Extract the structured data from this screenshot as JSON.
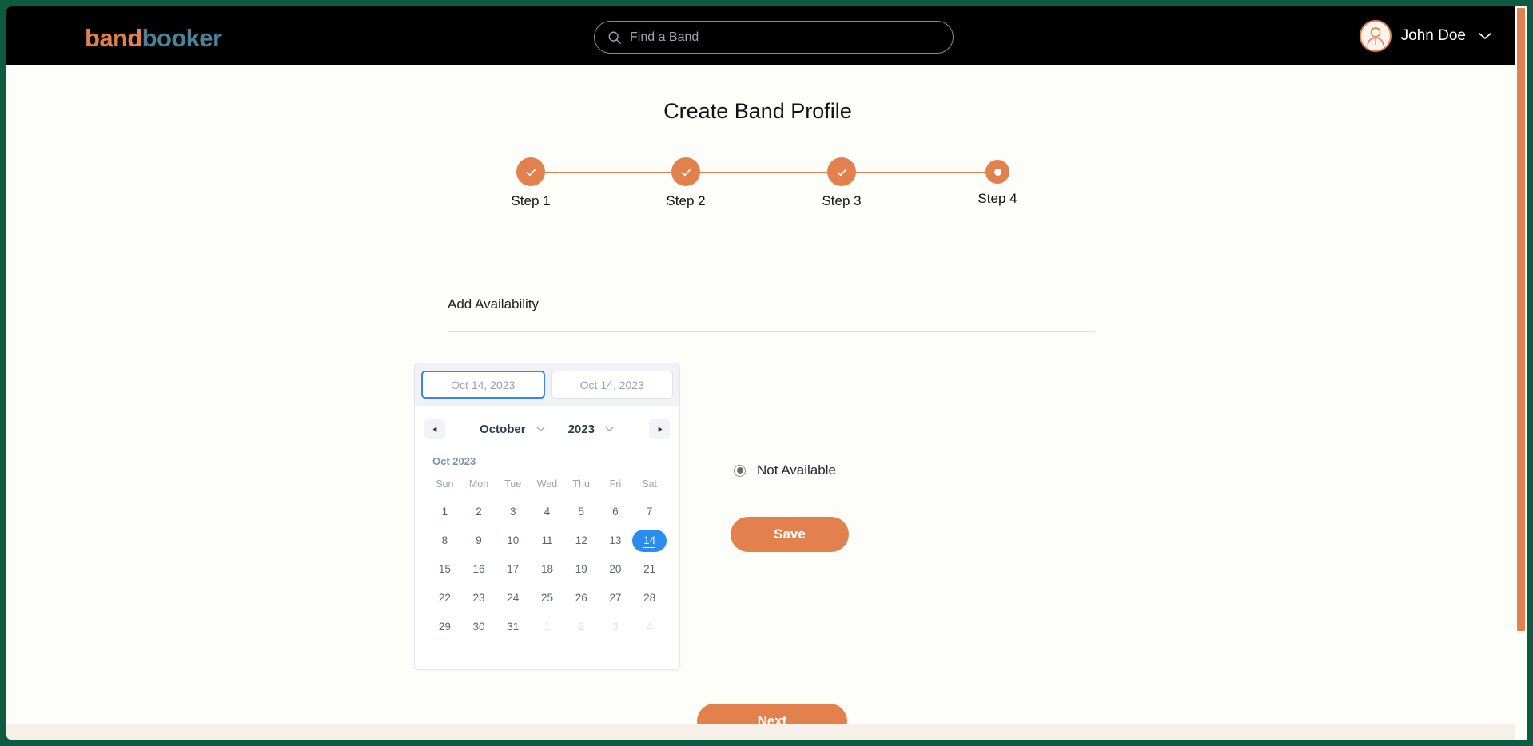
{
  "header": {
    "logo_part1": "band",
    "logo_part2": "booker",
    "logo_color_1": "#e2814e",
    "logo_color_2": "#4a8296",
    "search": {
      "value": "",
      "placeholder": "Find a Band",
      "icon": "search-icon"
    },
    "notifications": {
      "icon": "bell-icon",
      "has_unread_dot": true,
      "dot_color": "#e2814e"
    },
    "user": {
      "name": "John Doe",
      "avatar_icon": "user-avatar-icon",
      "chevron_icon": "chevron-down-icon"
    }
  },
  "main": {
    "title": "Create Band Profile",
    "stepper": {
      "accent_color": "#e2814e",
      "steps": [
        {
          "label": "Step 1",
          "state": "completed",
          "icon": "check-icon"
        },
        {
          "label": "Step 2",
          "state": "completed",
          "icon": "check-icon"
        },
        {
          "label": "Step 3",
          "state": "completed",
          "icon": "check-icon"
        },
        {
          "label": "Step 4",
          "state": "current",
          "icon": "dot-icon"
        }
      ]
    },
    "section": {
      "heading": "Add Availability"
    },
    "date_picker": {
      "start_date": "Oct 14, 2023",
      "end_date": "Oct 14, 2023",
      "active_tab": "start",
      "focus_color": "#3b82f6",
      "prev_icon": "triangle-left-icon",
      "next_icon": "triangle-right-icon",
      "month": "October",
      "year": "2023",
      "month_chevron_icon": "chevron-down-icon",
      "year_chevron_icon": "chevron-down-icon",
      "caption": "Oct 2023",
      "weekdays": [
        "Sun",
        "Mon",
        "Tue",
        "Wed",
        "Thu",
        "Fri",
        "Sat"
      ],
      "selected_day": "14",
      "selected_color": "#2b8cf0",
      "weeks": [
        [
          {
            "d": "1",
            "muted": false
          },
          {
            "d": "2",
            "muted": false
          },
          {
            "d": "3",
            "muted": false
          },
          {
            "d": "4",
            "muted": false
          },
          {
            "d": "5",
            "muted": false
          },
          {
            "d": "6",
            "muted": false
          },
          {
            "d": "7",
            "muted": false
          }
        ],
        [
          {
            "d": "8",
            "muted": false
          },
          {
            "d": "9",
            "muted": false
          },
          {
            "d": "10",
            "muted": false
          },
          {
            "d": "11",
            "muted": false
          },
          {
            "d": "12",
            "muted": false
          },
          {
            "d": "13",
            "muted": false
          },
          {
            "d": "14",
            "muted": false,
            "selected": true
          }
        ],
        [
          {
            "d": "15",
            "muted": false
          },
          {
            "d": "16",
            "muted": false
          },
          {
            "d": "17",
            "muted": false
          },
          {
            "d": "18",
            "muted": false
          },
          {
            "d": "19",
            "muted": false
          },
          {
            "d": "20",
            "muted": false
          },
          {
            "d": "21",
            "muted": false
          }
        ],
        [
          {
            "d": "22",
            "muted": false
          },
          {
            "d": "23",
            "muted": false
          },
          {
            "d": "24",
            "muted": false
          },
          {
            "d": "25",
            "muted": false
          },
          {
            "d": "26",
            "muted": false
          },
          {
            "d": "27",
            "muted": false
          },
          {
            "d": "28",
            "muted": false
          }
        ],
        [
          {
            "d": "29",
            "muted": false
          },
          {
            "d": "30",
            "muted": false
          },
          {
            "d": "31",
            "muted": false
          },
          {
            "d": "1",
            "muted": true
          },
          {
            "d": "2",
            "muted": true
          },
          {
            "d": "3",
            "muted": true
          },
          {
            "d": "4",
            "muted": true
          }
        ]
      ]
    },
    "availability": {
      "option_label": "Not Available",
      "selected": true
    },
    "save_button": "Save",
    "next_button": "Next",
    "button_color": "#e2814e"
  },
  "chrome": {
    "frame_color": "#0d5c42",
    "scrollbar_color": "#e2814e"
  }
}
